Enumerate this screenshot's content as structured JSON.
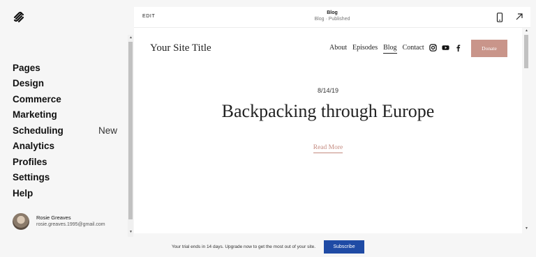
{
  "sidebar": {
    "logo_icon": "squarespace-logo-icon",
    "items": [
      {
        "label": "Pages",
        "badge": ""
      },
      {
        "label": "Design",
        "badge": ""
      },
      {
        "label": "Commerce",
        "badge": ""
      },
      {
        "label": "Marketing",
        "badge": ""
      },
      {
        "label": "Scheduling",
        "badge": "New"
      },
      {
        "label": "Analytics",
        "badge": ""
      },
      {
        "label": "Profiles",
        "badge": ""
      },
      {
        "label": "Settings",
        "badge": ""
      },
      {
        "label": "Help",
        "badge": ""
      }
    ],
    "user": {
      "name": "Rosie Greaves",
      "email": "rosie.greaves.1995@gmail.com"
    }
  },
  "preview_bar": {
    "edit_label": "EDIT",
    "page_title": "Blog",
    "page_status": "Blog · Published",
    "mobile_icon": "mobile-phone-icon",
    "expand_icon": "expand-arrow-icon"
  },
  "site": {
    "title": "Your Site Title",
    "nav": [
      "About",
      "Episodes",
      "Blog",
      "Contact"
    ],
    "active_nav": "Blog",
    "social_icons": [
      "instagram-icon",
      "youtube-icon",
      "facebook-icon"
    ],
    "donate_label": "Donate",
    "accent_color": "#c9958a"
  },
  "post": {
    "date": "8/14/19",
    "title": "Backpacking through Europe",
    "read_more": "Read More"
  },
  "trial": {
    "message": "Your trial ends in 14 days. Upgrade now to get the most out of your site.",
    "subscribe_label": "Subscribe",
    "button_color": "#1f4ba5"
  }
}
